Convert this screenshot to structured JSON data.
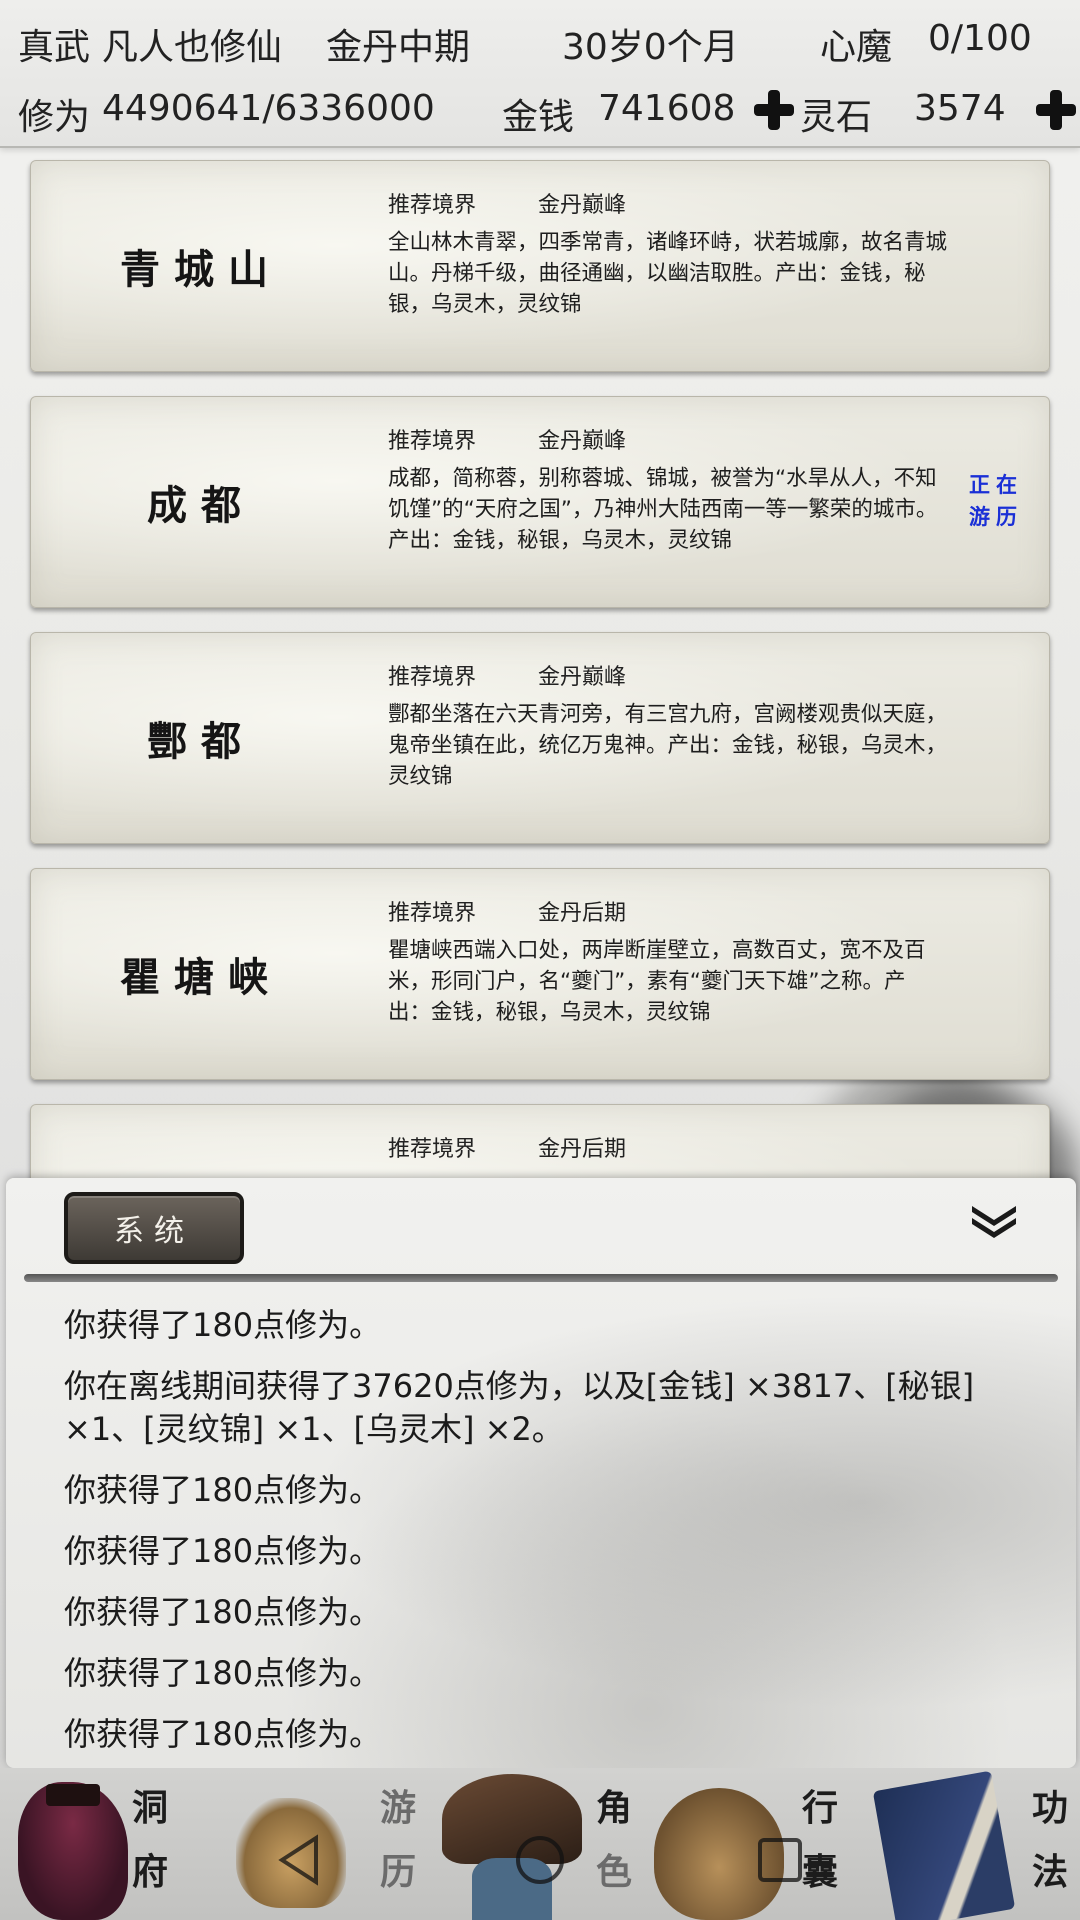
{
  "header": {
    "sect": "真武",
    "name": "凡人也修仙",
    "realm": "金丹中期",
    "age": "30岁0个月",
    "heart_demon_label": "心魔",
    "heart_demon_value": "0/100",
    "cultivation_label": "修为",
    "cultivation_value": "4490641/6336000",
    "money_label": "金钱",
    "money_value": "741608",
    "spirit_stone_label": "灵石",
    "spirit_stone_value": "3574"
  },
  "locations": [
    {
      "name": "青城山",
      "realm_label": "推荐境界",
      "realm_value": "金丹巅峰",
      "description": "全山林木青翠，四季常青，诸峰环峙，状若城廓，故名青城山。丹梯千级，曲径通幽，以幽洁取胜。产出：金钱，秘银，乌灵木，灵纹锦",
      "status": ""
    },
    {
      "name": "成都",
      "realm_label": "推荐境界",
      "realm_value": "金丹巅峰",
      "description": "成都，简称蓉，别称蓉城、锦城，被誉为“水旱从人，不知饥馑”的“天府之国”，乃神州大陆西南一等一繁荣的城市。产出：金钱，秘银，乌灵木，灵纹锦",
      "status": "正在游历"
    },
    {
      "name": "酆都",
      "realm_label": "推荐境界",
      "realm_value": "金丹巅峰",
      "description": "酆都坐落在六天青河旁，有三宫九府，宫阙楼观贵似天庭，鬼帝坐镇在此，统亿万鬼神。产出：金钱，秘银，乌灵木，灵纹锦",
      "status": ""
    },
    {
      "name": "瞿塘峡",
      "realm_label": "推荐境界",
      "realm_value": "金丹后期",
      "description": "瞿塘峡西端入口处，两岸断崖壁立，高数百丈，宽不及百米，形同门户，名“夔门”，素有“夔门天下雄”之称。产出：金钱，秘银，乌灵木，灵纹锦",
      "status": ""
    },
    {
      "name": "",
      "realm_label": "推荐境界",
      "realm_value": "金丹后期",
      "description": "",
      "status": ""
    }
  ],
  "system_panel": {
    "tab_label": "系统",
    "collapse_icon": "double-chevron-down-icon",
    "log": [
      "你获得了180点修为。",
      "你在离线期间获得了37620点修为，以及[金钱] ×3817、[秘银] ×1、[灵纹锦] ×1、[乌灵木] ×2。",
      "你获得了180点修为。",
      "你获得了180点修为。",
      "你获得了180点修为。",
      "你获得了180点修为。",
      "你获得了180点修为。"
    ]
  },
  "bottom_nav": [
    {
      "label_top": "洞",
      "label_bottom": "府",
      "icon": "robe-figure-icon"
    },
    {
      "label_top": "游",
      "label_bottom": "历",
      "icon": "grass-icon"
    },
    {
      "label_top": "角",
      "label_bottom": "色",
      "icon": "bamboo-hat-icon"
    },
    {
      "label_top": "行",
      "label_bottom": "囊",
      "icon": "bag-icon"
    },
    {
      "label_top": "功",
      "label_bottom": "法",
      "icon": "book-icon"
    }
  ],
  "colors": {
    "status_blue": "#1a2fd6",
    "tab_dark": "#3e3a35",
    "card_paper": "#e6e4da"
  }
}
